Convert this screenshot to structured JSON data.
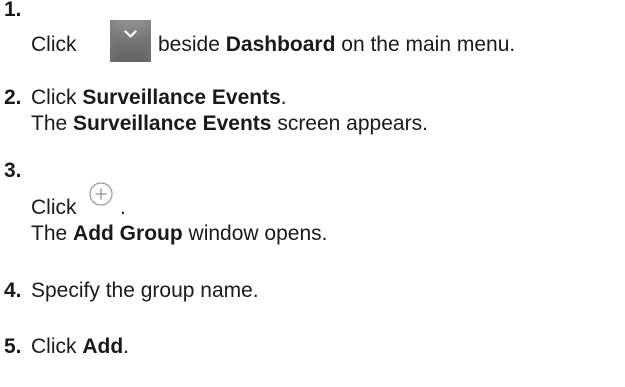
{
  "steps": [
    {
      "number": "1.",
      "text_before": "Click",
      "icon": "chevron-down-icon",
      "text_after": "beside",
      "bold": "Dashboard",
      "text_end": "on the main menu."
    },
    {
      "number": "2.",
      "text_before": "Click",
      "bold": "Surveillance Events",
      "text_end": ".",
      "line2_before": "The",
      "line2_bold": "Surveillance Events",
      "line2_end": "screen appears."
    },
    {
      "number": "3.",
      "text_before": "Click",
      "icon": "plus-circle-icon",
      "text_end": ".",
      "line2_before": "The",
      "line2_bold": "Add Group",
      "line2_end": "window opens."
    },
    {
      "number": "4.",
      "text": "Specify the group name."
    },
    {
      "number": "5.",
      "text_before": "Click",
      "bold": "Add",
      "text_end": "."
    }
  ],
  "colors": {
    "text": "#1a1a1a",
    "dropdown_button_bg": "#7a7a7a",
    "plus_icon_stroke": "#9a9a9a"
  }
}
